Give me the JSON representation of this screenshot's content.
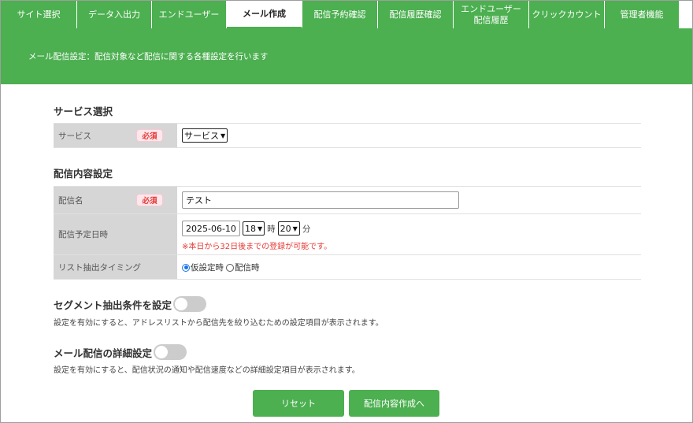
{
  "nav": {
    "tabs": [
      {
        "label": "サイト選択"
      },
      {
        "label": "データ入出力"
      },
      {
        "label": "エンドユーザー"
      },
      {
        "label": "メール作成",
        "active": true
      },
      {
        "label": "配信予約確認"
      },
      {
        "label": "配信履歴確認"
      },
      {
        "label": "エンドユーザー\n配信履歴"
      },
      {
        "label": "クリックカウント"
      },
      {
        "label": "管理者機能"
      }
    ]
  },
  "banner": {
    "text": "メール配信設定：配信対象など配信に関する各種設定を行います"
  },
  "service_section": {
    "title": "サービス選択",
    "service_label": "サービス",
    "required_badge": "必須",
    "service_select_value": "サービス"
  },
  "content_section": {
    "title": "配信内容設定",
    "name_label": "配信名",
    "required_badge": "必須",
    "name_value": "テスト",
    "schedule_label": "配信予定日時",
    "date_value": "2025-06-10",
    "hour_value": "18",
    "hour_unit": "時",
    "minute_value": "20",
    "minute_unit": "分",
    "schedule_warning": "※本日から32日後までの登録が可能です。",
    "timing_label": "リスト抽出タイミング",
    "timing_options": [
      "仮設定時",
      "配信時"
    ],
    "timing_selected": "仮設定時"
  },
  "segment": {
    "title": "セグメント抽出条件を設定",
    "enabled": false,
    "description": "設定を有効にすると、アドレスリストから配信先を絞り込むための設定項目が表示されます。"
  },
  "detail": {
    "title": "メール配信の詳細設定",
    "enabled": false,
    "description": "設定を有効にすると、配信状況の通知や配信速度などの詳細設定項目が表示されます。"
  },
  "actions": {
    "reset_label": "リセット",
    "next_label": "配信内容作成へ"
  },
  "colors": {
    "primary": "#4caf50",
    "warning": "#e53935",
    "label_bg": "#d6d6d6"
  }
}
